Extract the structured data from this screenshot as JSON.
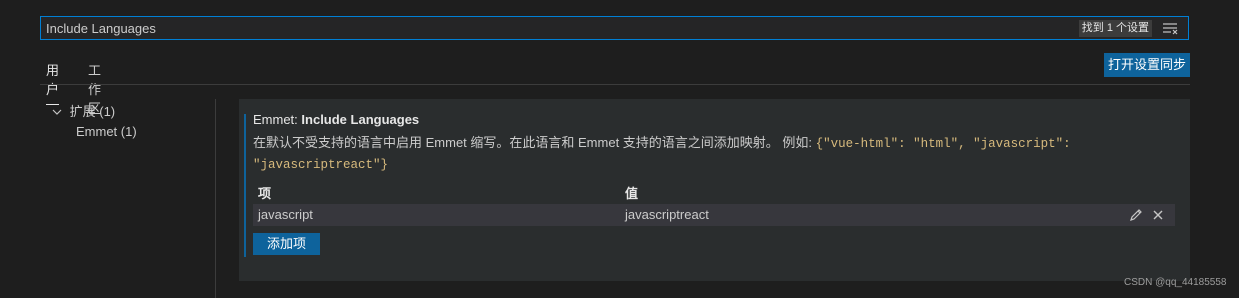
{
  "search": {
    "value": "Include Languages",
    "result_count": "找到 1 个设置",
    "filter_icon": "filter-list-icon"
  },
  "tabs": [
    {
      "label": "用户",
      "active": true
    },
    {
      "label": "工作区",
      "active": false
    }
  ],
  "sync_button": {
    "label": "打开设置同步"
  },
  "toc": {
    "group_label": "扩展 (1)",
    "sub_label": "Emmet (1)"
  },
  "setting": {
    "category": "Emmet: ",
    "name": "Include Languages",
    "description": "在默认不受支持的语言中启用 Emmet 缩写。在此语言和 Emmet 支持的语言之间添加映射。 例如: ",
    "example_code": "{\"vue-html\": \"html\", \"javascript\": \"javascriptreact\"}",
    "table": {
      "headers": {
        "key": "项",
        "value": "值"
      },
      "rows": [
        {
          "key": "javascript",
          "value": "javascriptreact"
        }
      ]
    },
    "add_item_label": "添加项"
  },
  "watermark": "CSDN @qq_44185558",
  "colors": {
    "background": "#1e1e1e",
    "accent": "#0e639c",
    "focus_border": "#007fd4"
  }
}
